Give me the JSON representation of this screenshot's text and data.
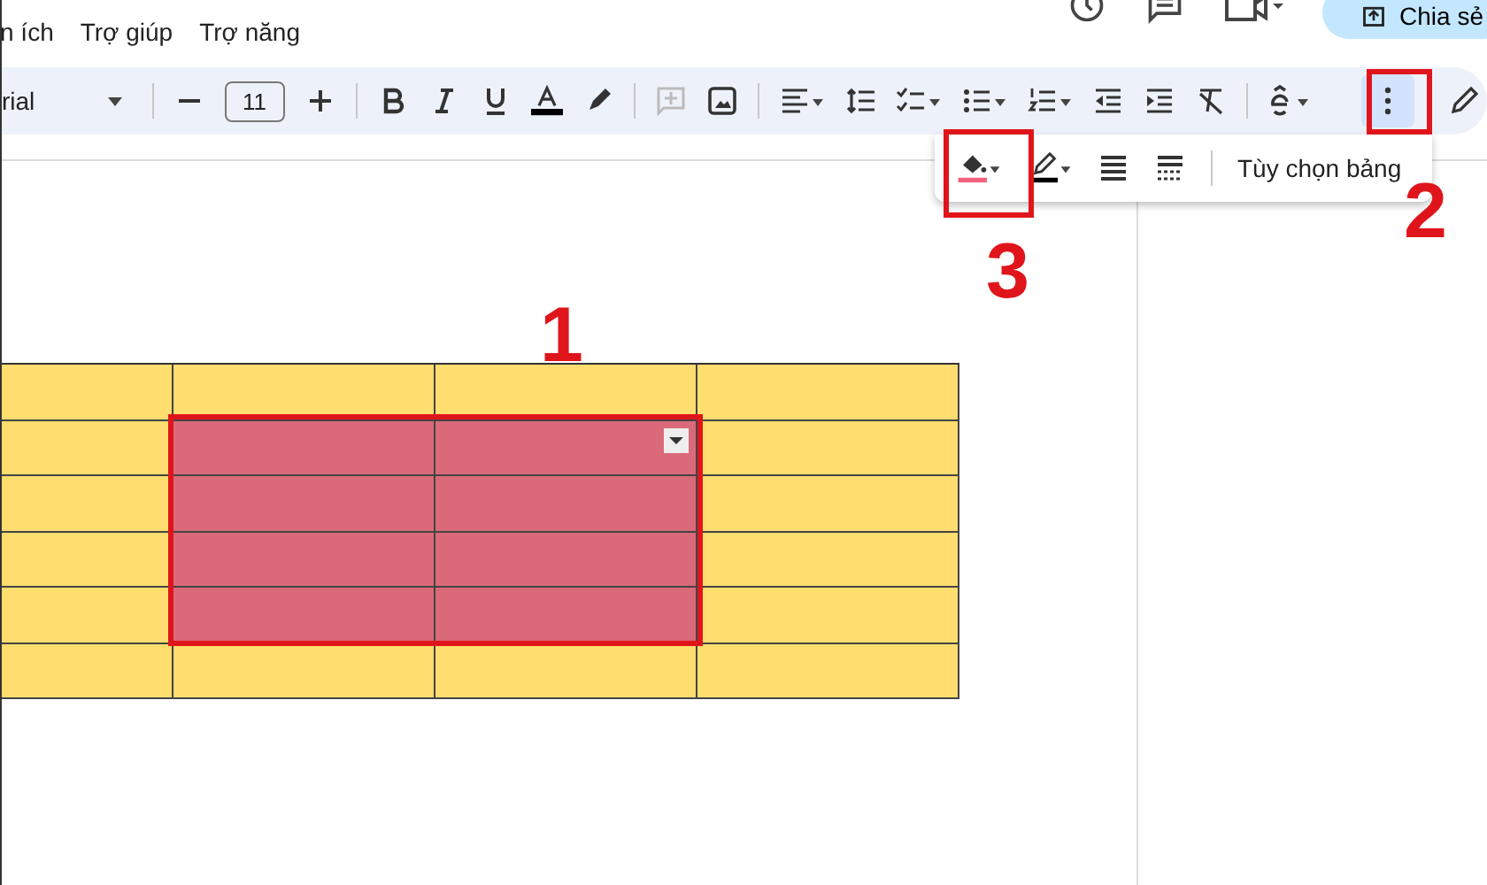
{
  "menu_bar": {
    "items": [
      "n ích",
      "Trợ giúp",
      "Trợ năng"
    ]
  },
  "share_button": {
    "label": "Chia sẻ"
  },
  "toolbar": {
    "font": "rial",
    "font_size": "11"
  },
  "table_toolbar": {
    "options_label": "Tùy chọn bảng"
  },
  "table": {
    "rows": [
      [
        {
          "selected": false
        },
        {
          "selected": false
        },
        {
          "selected": false
        },
        {
          "selected": false
        }
      ],
      [
        {
          "selected": false
        },
        {
          "selected": true
        },
        {
          "selected": true
        },
        {
          "selected": false
        }
      ],
      [
        {
          "selected": false
        },
        {
          "selected": true
        },
        {
          "selected": true
        },
        {
          "selected": false
        }
      ],
      [
        {
          "selected": false
        },
        {
          "selected": true
        },
        {
          "selected": true
        },
        {
          "selected": false
        }
      ],
      [
        {
          "selected": false
        },
        {
          "selected": true
        },
        {
          "selected": true
        },
        {
          "selected": false
        }
      ],
      [
        {
          "selected": false
        },
        {
          "selected": false
        },
        {
          "selected": false
        },
        {
          "selected": false
        }
      ]
    ]
  },
  "annotations": [
    {
      "label": "1"
    },
    {
      "label": "2"
    },
    {
      "label": "3"
    }
  ]
}
